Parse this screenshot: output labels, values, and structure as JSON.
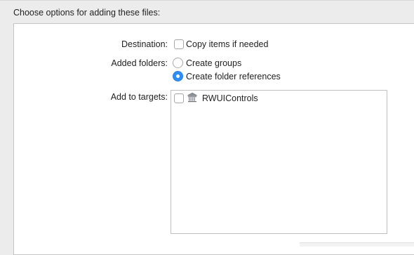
{
  "dialog": {
    "header": "Choose options for adding these files:",
    "destination": {
      "label": "Destination:",
      "checkbox_label": "Copy items if needed",
      "checked": false
    },
    "added_folders": {
      "label": "Added folders:",
      "options": [
        {
          "label": "Create groups",
          "selected": false
        },
        {
          "label": "Create folder references",
          "selected": true
        }
      ]
    },
    "add_to_targets": {
      "label": "Add to targets:",
      "targets": [
        {
          "name": "RWUIControls",
          "checked": false,
          "icon": "framework-target-icon"
        }
      ]
    }
  },
  "colors": {
    "background": "#ececec",
    "panel": "#ffffff",
    "accent": "#2f8ef5",
    "border": "#c6c6c6"
  }
}
